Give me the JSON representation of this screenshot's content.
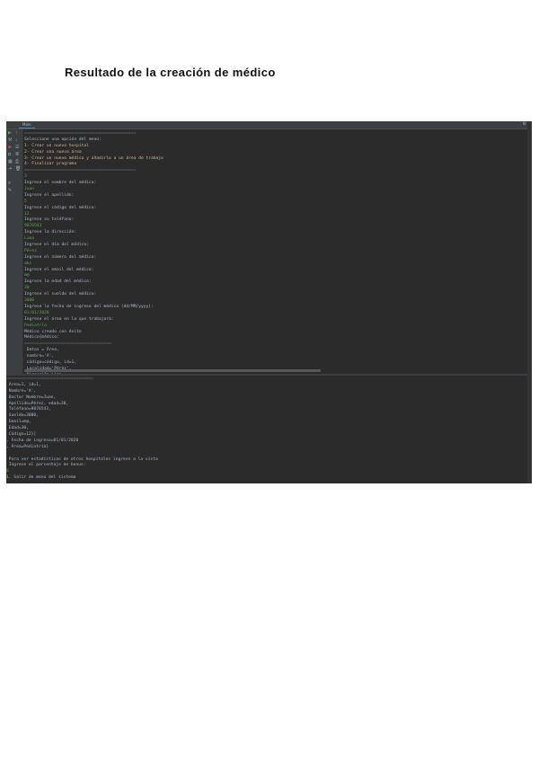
{
  "document": {
    "title": "Resultado de la creación de médico"
  },
  "ide": {
    "tab_label": "Main",
    "upper_console": [
      {
        "t": "=============================================",
        "k": "sep"
      },
      {
        "t": "Seleccione una opción del menú:",
        "k": "out"
      },
      {
        "t": "1- Crear un nuevo hospital",
        "k": "menu"
      },
      {
        "t": "2- Crear una nueva área",
        "k": "menu"
      },
      {
        "t": "3- Crear un nuevo médico y añadirlo a un área de trabajo",
        "k": "menu"
      },
      {
        "t": "4- Finalizar programa",
        "k": "menu"
      },
      {
        "t": "=============================================",
        "k": "sep"
      },
      {
        "t": "3",
        "k": "in"
      },
      {
        "t": "Ingrese el nombre del médico:",
        "k": "out"
      },
      {
        "t": "Juan",
        "k": "in"
      },
      {
        "t": "Ingrese el apellido:",
        "k": "out"
      },
      {
        "t": "5",
        "k": "in"
      },
      {
        "t": "Ingrese el código del médico:",
        "k": "out"
      },
      {
        "t": "12",
        "k": "in"
      },
      {
        "t": "Ingrese su teléfono:",
        "k": "out"
      },
      {
        "t": "9876543",
        "k": "in"
      },
      {
        "t": "Ingrese la dirección:",
        "k": "out"
      },
      {
        "t": "Lima",
        "k": "in"
      },
      {
        "t": "Ingrese el día del médico:",
        "k": "out"
      },
      {
        "t": "Pérez",
        "k": "in"
      },
      {
        "t": "Ingrese el número del médico:",
        "k": "out"
      },
      {
        "t": "abc",
        "k": "in"
      },
      {
        "t": "Ingrese el email del médico:",
        "k": "out"
      },
      {
        "t": "m@",
        "k": "in"
      },
      {
        "t": "Ingrese la edad del médico:",
        "k": "out"
      },
      {
        "t": "30",
        "k": "in"
      },
      {
        "t": "Ingrese el sueldo del médico:",
        "k": "out"
      },
      {
        "t": "3000",
        "k": "in"
      },
      {
        "t": "Ingrese la fecha de ingreso del médico (dd/MM/yyyy):",
        "k": "out"
      },
      {
        "t": "01/01/2020",
        "k": "in"
      },
      {
        "t": "Ingrese el área en la que trabajará:",
        "k": "out"
      },
      {
        "t": "Pediatría",
        "k": "in"
      },
      {
        "t": "Médico creado con éxito",
        "k": "out"
      },
      {
        "t": "Médico{médico:",
        "k": "out"
      },
      {
        "t": "===================================",
        "k": "sep"
      },
      {
        "t": " Datos = Área,",
        "k": "out"
      },
      {
        "t": " nombre='A',",
        "k": "out"
      },
      {
        "t": " código=código, id=1,",
        "k": "out"
      },
      {
        "t": " Localidad='Pérez',",
        "k": "out"
      },
      {
        "t": " Dirección=Lima,",
        "k": "out"
      }
    ],
    "lower_console": [
      {
        "t": "===================================",
        "k": "sep"
      },
      {
        "t": " Área=1, id=1,",
        "k": "out"
      },
      {
        "t": " Nombre='A',",
        "k": "out"
      },
      {
        "t": " Doctor Nombre=Juan,",
        "k": "out"
      },
      {
        "t": " Apellido=Pérez, edad=30,",
        "k": "out"
      },
      {
        "t": " Teléfono=9876543,",
        "k": "out"
      },
      {
        "t": " Sueldo=3000,",
        "k": "out"
      },
      {
        "t": " Email=m@,",
        "k": "out"
      },
      {
        "t": " Edad=30,",
        "k": "out"
      },
      {
        "t": " Código=12}]",
        "k": "out"
      },
      {
        "t": ", Fecha de ingreso=01/01/2020",
        "k": "out"
      },
      {
        "t": ", Área=Pediatría}",
        "k": "out"
      },
      {
        "t": "",
        "k": "out"
      },
      {
        "t": " Para ver estadísticas de otros hospitales ingrese a la vista",
        "k": "out"
      },
      {
        "t": " Ingrese el porcentaje de bonus:",
        "k": "out"
      },
      {
        "t": "0",
        "k": "in"
      },
      {
        "t": "1. Salir de menú del sistema",
        "k": "out"
      }
    ]
  }
}
